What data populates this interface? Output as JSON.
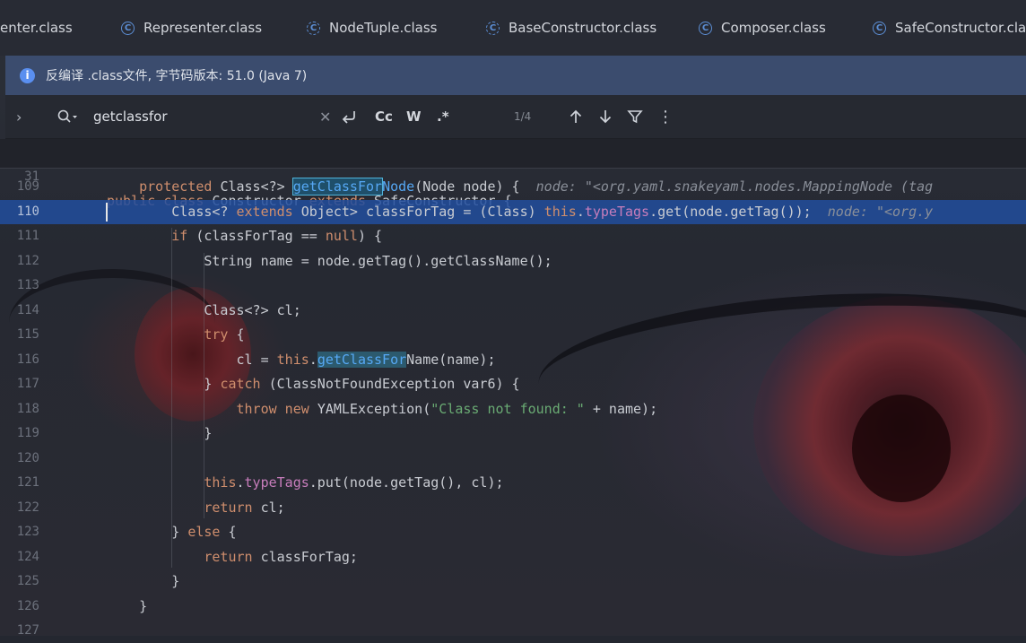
{
  "tabs": [
    {
      "label": "enter.class"
    },
    {
      "label": "Representer.class",
      "icon": "class-icon"
    },
    {
      "label": "NodeTuple.class",
      "icon": "class-icon-dashed"
    },
    {
      "label": "BaseConstructor.class",
      "icon": "class-icon-dashed"
    },
    {
      "label": "Composer.class",
      "icon": "class-icon"
    },
    {
      "label": "SafeConstructor.class",
      "icon": "class-icon"
    }
  ],
  "banner": {
    "icon": "info-icon",
    "text": "反编译 .class文件, 字节码版本: 51.0 (Java 7)"
  },
  "search": {
    "query": "getclassfor",
    "match_count": "1/4",
    "case_label": "Cc",
    "words_label": "W",
    "regex_label": ".*"
  },
  "sticky_line": {
    "number": "31",
    "tokens": [
      {
        "t": "public class ",
        "c": "kw"
      },
      {
        "t": "Constructor ",
        "c": ""
      },
      {
        "t": "extends ",
        "c": "kw"
      },
      {
        "t": "SafeConstructor {",
        "c": ""
      }
    ]
  },
  "lines": [
    {
      "n": "109",
      "indent": "    ",
      "tokens": [
        {
          "t": "protected ",
          "c": "kw"
        },
        {
          "t": "Class<?> ",
          "c": ""
        },
        {
          "t": "getClassFor",
          "c": "fn match active"
        },
        {
          "t": "Node",
          "c": "fn"
        },
        {
          "t": "(Node node) {  ",
          "c": ""
        },
        {
          "t": "node: \"<org.yaml.snakeyaml.nodes.MappingNode (tag",
          "c": "hint"
        }
      ]
    },
    {
      "n": "110",
      "indent": "        ",
      "current": true,
      "tokens": [
        {
          "t": "Class<? ",
          "c": ""
        },
        {
          "t": "extends ",
          "c": "kw"
        },
        {
          "t": "Object> classForTag = (Class) ",
          "c": ""
        },
        {
          "t": "this",
          "c": "kw"
        },
        {
          "t": ".",
          "c": ""
        },
        {
          "t": "typeTags",
          "c": "fld"
        },
        {
          "t": ".get(node.getTag());  ",
          "c": ""
        },
        {
          "t": "node: \"<org.y",
          "c": "hint"
        }
      ]
    },
    {
      "n": "111",
      "indent": "        ",
      "tokens": [
        {
          "t": "if ",
          "c": "kw"
        },
        {
          "t": "(classForTag == ",
          "c": ""
        },
        {
          "t": "null",
          "c": "kw"
        },
        {
          "t": ") {",
          "c": ""
        }
      ]
    },
    {
      "n": "112",
      "indent": "            ",
      "tokens": [
        {
          "t": "String name = node.getTag().getClassName();",
          "c": ""
        }
      ]
    },
    {
      "n": "113",
      "indent": "",
      "tokens": []
    },
    {
      "n": "114",
      "indent": "            ",
      "tokens": [
        {
          "t": "Class<?> cl;",
          "c": ""
        }
      ]
    },
    {
      "n": "115",
      "indent": "            ",
      "tokens": [
        {
          "t": "try ",
          "c": "kw"
        },
        {
          "t": "{",
          "c": ""
        }
      ]
    },
    {
      "n": "116",
      "indent": "                ",
      "tokens": [
        {
          "t": "cl = ",
          "c": ""
        },
        {
          "t": "this",
          "c": "kw"
        },
        {
          "t": ".",
          "c": ""
        },
        {
          "t": "getClassFor",
          "c": "fn match"
        },
        {
          "t": "Name(name);",
          "c": ""
        }
      ]
    },
    {
      "n": "117",
      "indent": "            ",
      "tokens": [
        {
          "t": "} ",
          "c": ""
        },
        {
          "t": "catch ",
          "c": "kw"
        },
        {
          "t": "(ClassNotFoundException var6) {",
          "c": ""
        }
      ]
    },
    {
      "n": "118",
      "indent": "                ",
      "tokens": [
        {
          "t": "throw new ",
          "c": "kw"
        },
        {
          "t": "YAMLException(",
          "c": ""
        },
        {
          "t": "\"Class not found: \"",
          "c": "str"
        },
        {
          "t": " + name);",
          "c": ""
        }
      ]
    },
    {
      "n": "119",
      "indent": "            ",
      "tokens": [
        {
          "t": "}",
          "c": ""
        }
      ]
    },
    {
      "n": "120",
      "indent": "",
      "tokens": []
    },
    {
      "n": "121",
      "indent": "            ",
      "tokens": [
        {
          "t": "this",
          "c": "kw"
        },
        {
          "t": ".",
          "c": ""
        },
        {
          "t": "typeTags",
          "c": "fld"
        },
        {
          "t": ".put(node.getTag(), cl);",
          "c": ""
        }
      ]
    },
    {
      "n": "122",
      "indent": "            ",
      "tokens": [
        {
          "t": "return ",
          "c": "kw"
        },
        {
          "t": "cl;",
          "c": ""
        }
      ]
    },
    {
      "n": "123",
      "indent": "        ",
      "tokens": [
        {
          "t": "} ",
          "c": ""
        },
        {
          "t": "else ",
          "c": "kw"
        },
        {
          "t": "{",
          "c": ""
        }
      ]
    },
    {
      "n": "124",
      "indent": "            ",
      "tokens": [
        {
          "t": "return ",
          "c": "kw"
        },
        {
          "t": "classForTag;",
          "c": ""
        }
      ]
    },
    {
      "n": "125",
      "indent": "        ",
      "tokens": [
        {
          "t": "}",
          "c": ""
        }
      ]
    },
    {
      "n": "126",
      "indent": "    ",
      "tokens": [
        {
          "t": "}",
          "c": ""
        }
      ]
    },
    {
      "n": "127",
      "indent": "",
      "tokens": []
    }
  ]
}
